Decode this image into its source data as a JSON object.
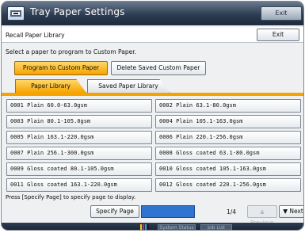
{
  "window": {
    "title": "Tray Paper Settings",
    "exit_label": "Exit"
  },
  "recall": {
    "label": "Recall Paper Library",
    "exit_label": "Exit"
  },
  "instructions": "Select a paper to program to Custom Paper.",
  "actions": {
    "program_label": "Program to Custom Paper",
    "delete_label": "Delete Saved Custom Paper"
  },
  "tabs": [
    {
      "label": "Paper Library",
      "selected": true
    },
    {
      "label": "Saved Paper Library",
      "selected": false
    }
  ],
  "papers": [
    "0001 Plain 60.0-63.0gsm",
    "0002 Plain 63.1-80.0gsm",
    "0003 Plain 80.1-105.0gsm",
    "0004 Plain 105.1-163.0gsm",
    "0005 Plain 163.1-220.0gsm",
    "0006 Plain 220.1-256.0gsm",
    "0007 Plain 256.1-300.0gsm",
    "0008 Gloss coated 63.1-80.0gsm",
    "0009 Gloss coated 80.1-105.0gsm",
    "0010 Gloss coated 105.1-163.0gsm",
    "0011 Gloss coated 163.1-220.0gsm",
    "0012 Gloss coated 220.1-256.0gsm"
  ],
  "footer": {
    "press_text": "Press [Specify Page] to specify page to display.",
    "specify_label": "Specify Page",
    "page_indicator": "1/4",
    "prev_label": "▲ Previous",
    "next_label": "▼ Next"
  },
  "statusbar": {
    "status_label": "System Status",
    "job_label": "Job List"
  },
  "icons": {
    "title_icon": "tray-icon",
    "toner_icon": "toner-level-icon"
  },
  "colors": {
    "accent": "#f6a300",
    "titlebar": "#2c3c52",
    "page_field": "#2f75d0"
  }
}
